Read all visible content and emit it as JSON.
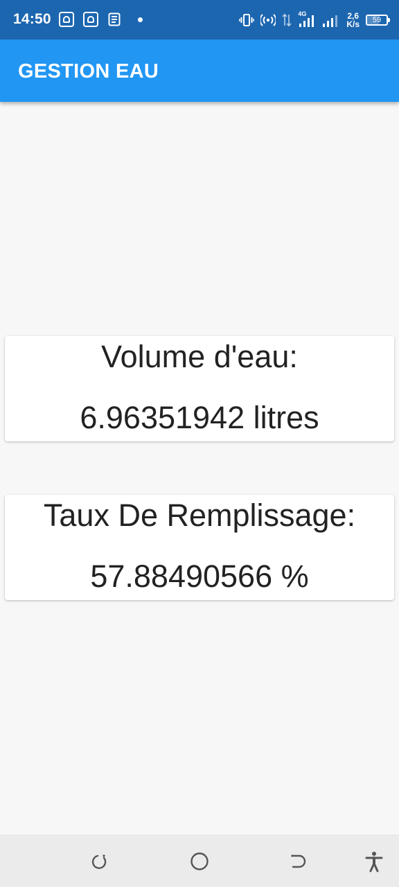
{
  "status_bar": {
    "time": "14:50",
    "network_type": "4G",
    "speed_value": "2,6",
    "speed_unit": "K/s",
    "battery_level": "59",
    "icons": [
      "keyboard-icon",
      "keyboard-icon",
      "news-icon",
      "notification-dot",
      "vibrate-icon",
      "hotspot-icon",
      "data-arrows-icon",
      "signal-icon",
      "signal-icon",
      "battery-icon"
    ]
  },
  "app_bar": {
    "title": "GESTION EAU",
    "color": "#2196f3"
  },
  "cards": {
    "volume": {
      "label": "Volume d'eau:",
      "value": "6.96351942 litres"
    },
    "taux": {
      "label": "Taux De Remplissage:",
      "value": "57.88490566 %"
    }
  },
  "nav_bar": {
    "buttons": [
      "recent-apps-icon",
      "home-icon",
      "back-icon",
      "accessibility-icon"
    ]
  }
}
